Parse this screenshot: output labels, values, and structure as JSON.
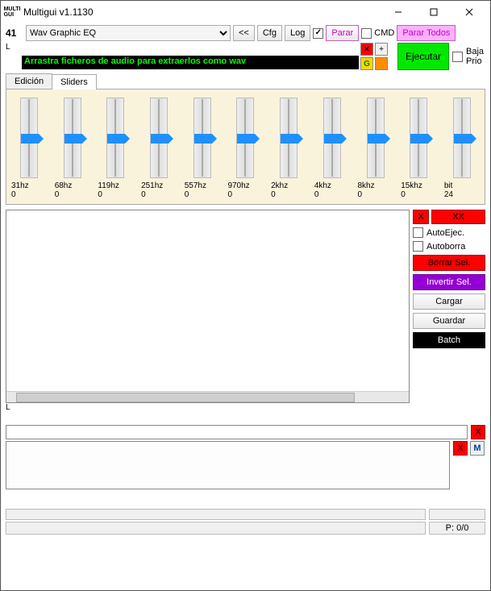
{
  "window": {
    "title": "Multigui v1.1130",
    "app_icon_text": "MULTI\nGUI"
  },
  "toolbar": {
    "num": "41",
    "dropdown_selected": "Wav Graphic EQ",
    "btn_back": "<<",
    "btn_cfg": "Cfg",
    "btn_log": "Log",
    "log_checked": true,
    "btn_parar": "Parar",
    "cmd_label": "CMD",
    "btn_parar_todos": "Parar Todos"
  },
  "row2": {
    "l_label": "L",
    "banner": "Arrastra ficheros de audio para extraerlos como wav",
    "mini_g": "G",
    "btn_ejecutar": "Ejecutar",
    "baja_l1": "Baja",
    "baja_l2": "Prio"
  },
  "tabs": {
    "t1": "Edición",
    "t2": "Sliders"
  },
  "sliders": [
    {
      "label": "31hz",
      "value": "0"
    },
    {
      "label": "68hz",
      "value": "0"
    },
    {
      "label": "119hz",
      "value": "0"
    },
    {
      "label": "251hz",
      "value": "0"
    },
    {
      "label": "557hz",
      "value": "0"
    },
    {
      "label": "970hz",
      "value": "0"
    },
    {
      "label": "2khz",
      "value": "0"
    },
    {
      "label": "4khz",
      "value": "0"
    },
    {
      "label": "8khz",
      "value": "0"
    },
    {
      "label": "15khz",
      "value": "0"
    },
    {
      "label": "bit",
      "value": "24"
    }
  ],
  "side": {
    "x": "X",
    "xx": "XX",
    "autoejec": "AutoEjec.",
    "autoborra": "Autoborra",
    "borrar": "Borrar Sel.",
    "invertir": "Invertir Sel.",
    "cargar": "Cargar",
    "guardar": "Guardar",
    "batch": "Batch"
  },
  "bottom": {
    "l_mark": "L",
    "x": "X",
    "m": "M",
    "status": "P: 0/0"
  },
  "chart_data": {
    "type": "bar",
    "title": "Wav Graphic EQ",
    "categories": [
      "31hz",
      "68hz",
      "119hz",
      "251hz",
      "557hz",
      "970hz",
      "2khz",
      "4khz",
      "8khz",
      "15khz",
      "bit"
    ],
    "values": [
      0,
      0,
      0,
      0,
      0,
      0,
      0,
      0,
      0,
      0,
      24
    ]
  }
}
